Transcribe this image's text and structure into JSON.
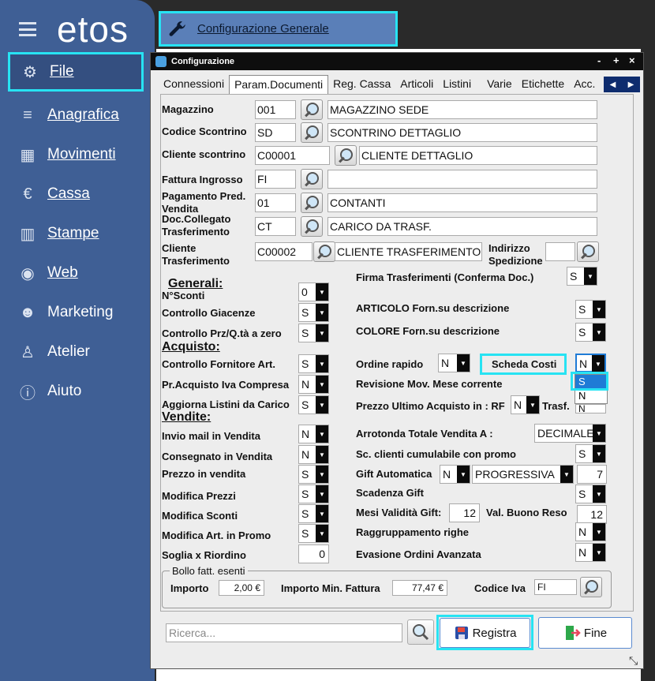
{
  "sidebar": {
    "logo": "etos",
    "items": [
      {
        "label": "File",
        "icon": "gear-icon",
        "glyph": "⚙"
      },
      {
        "label": "Anagrafica",
        "icon": "database-icon",
        "glyph": "≡"
      },
      {
        "label": "Movimenti",
        "icon": "boxes-icon",
        "glyph": "▦"
      },
      {
        "label": "Cassa",
        "icon": "euro-icon",
        "glyph": "€"
      },
      {
        "label": "Stampe",
        "icon": "bar-chart-icon",
        "glyph": "▥"
      },
      {
        "label": "Web",
        "icon": "globe-icon",
        "glyph": "◉"
      },
      {
        "label": "Marketing",
        "icon": "users-icon",
        "glyph": "☻"
      },
      {
        "label": "Atelier",
        "icon": "person-icon",
        "glyph": "♙"
      },
      {
        "label": "Aiuto",
        "icon": "info-icon",
        "glyph": "ⓘ"
      }
    ]
  },
  "topbar": {
    "config_button": "Configurazione Generale"
  },
  "dialog": {
    "title": "Configurazione",
    "controls": {
      "min": "-",
      "max": "+",
      "close": "×"
    },
    "tabs": [
      "Connessioni",
      "Param.Documenti",
      "Reg. Cassa",
      "Articoli",
      "Listini",
      "Varie",
      "Etichette",
      "Acc."
    ],
    "tab_nav": {
      "left": "◀",
      "right": "▶"
    }
  },
  "fields": {
    "magazzino": {
      "label": "Magazzino",
      "code": "001",
      "desc": "MAGAZZINO SEDE"
    },
    "codice_scontrino": {
      "label": "Codice Scontrino",
      "code": "SD",
      "desc": "SCONTRINO DETTAGLIO"
    },
    "cliente_scontrino": {
      "label": "Cliente scontrino",
      "code": "C00001",
      "desc": "CLIENTE DETTAGLIO"
    },
    "fattura_ingrosso": {
      "label": "Fattura Ingrosso",
      "code": "FI",
      "desc": ""
    },
    "pagamento": {
      "label1": "Pagamento Pred.",
      "label2": "Vendita",
      "code": "01",
      "desc": "CONTANTI"
    },
    "doc_collegato": {
      "label1": "Doc.Collegato",
      "label2": "Trasferimento",
      "code": "CT",
      "desc": "CARICO DA TRASF."
    },
    "cliente_trasf": {
      "label1": "Cliente",
      "label2": "Trasferimento",
      "code": "C00002",
      "desc": "CLIENTE TRASFERIMENTO"
    },
    "indirizzo": {
      "label1": "Indirizzo",
      "label2": "Spedizione",
      "code": ""
    }
  },
  "sections": {
    "generali": "Generali:",
    "acquisto": "Acquisto:",
    "vendite": "Vendite:"
  },
  "left_opts": [
    {
      "label": "N°Sconti",
      "value": "0"
    },
    {
      "label": "Controllo Giacenze",
      "value": "S"
    },
    {
      "label": "Controllo Prz/Q.tà a zero",
      "value": "S"
    },
    {
      "label": "Controllo Fornitore Art.",
      "value": "S"
    },
    {
      "label": "Pr.Acquisto Iva Compresa",
      "value": "N"
    },
    {
      "label": "Aggiorna Listini da Carico",
      "value": "S"
    },
    {
      "label": "Invio mail in Vendita",
      "value": "N"
    },
    {
      "label": "Consegnato in Vendita",
      "value": "N"
    },
    {
      "label": "Prezzo in vendita",
      "value": "S"
    },
    {
      "label": "Modifica Prezzi",
      "value": "S"
    },
    {
      "label": "Modifica Sconti",
      "value": "S"
    },
    {
      "label": "Modifica Art. in Promo",
      "value": "S"
    },
    {
      "label": "Soglia x Riordino",
      "value": "0"
    }
  ],
  "right_opts": {
    "firma": {
      "label": "Firma Trasferimenti (Conferma Doc.)",
      "value": "S"
    },
    "articolo": {
      "label": "ARTICOLO Forn.su descrizione",
      "value": "S"
    },
    "colore": {
      "label": "COLORE Forn.su descrizione",
      "value": "S"
    },
    "ordine_rapido": {
      "label": "Ordine rapido",
      "value": "N"
    },
    "scheda_costi": {
      "label": "Scheda Costi",
      "value": "N",
      "options": [
        "S",
        "N"
      ]
    },
    "revisione": {
      "label": "Revisione Mov. Mese corrente"
    },
    "prezzo_ultimo": {
      "label": "Prezzo Ultimo Acquisto in : RF",
      "value": "N",
      "trasf_label": "Trasf.",
      "trasf_value": "N"
    },
    "arrotonda": {
      "label": "Arrotonda Totale Vendita A :",
      "value": "DECIMALE"
    },
    "sc_clienti": {
      "label": "Sc. clienti cumulabile con promo",
      "value": "S"
    },
    "gift_auto": {
      "label": "Gift Automatica",
      "value": "N",
      "mode": "PROGRESSIVA",
      "num": "7"
    },
    "scadenza_gift": {
      "label": "Scadenza Gift",
      "value": "S"
    },
    "mesi_validita": {
      "label": "Mesi Validità Gift:",
      "value": "12",
      "buono_label": "Val. Buono Reso",
      "buono_value": "12"
    },
    "raggruppamento": {
      "label": "Raggruppamento righe",
      "value": "N"
    },
    "evasione": {
      "label": "Evasione Ordini Avanzata",
      "value": "N"
    }
  },
  "bollo": {
    "legend": "Bollo fatt. esenti",
    "importo_label": "Importo",
    "importo": "2,00 €",
    "min_label": "Importo Min. Fattura",
    "min": "77,47 €",
    "iva_label": "Codice Iva",
    "iva": "FI"
  },
  "footer": {
    "search_placeholder": "Ricerca...",
    "registra": "Registra",
    "fine": "Fine"
  }
}
